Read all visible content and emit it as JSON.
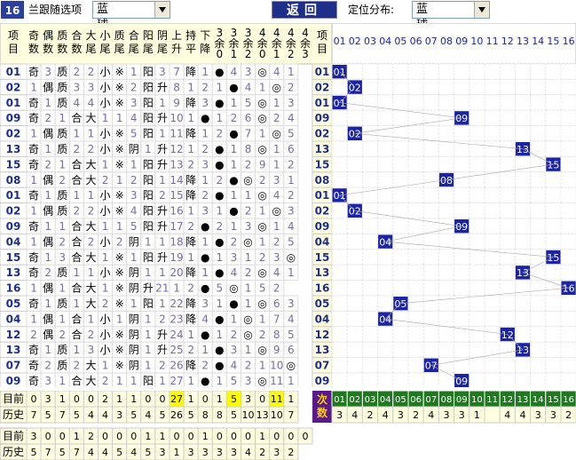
{
  "topbar": {
    "issue_badge": "16",
    "option_label": "兰跟随选项",
    "option_value": "蓝 球",
    "back_button": "返回",
    "dist_label": "定位分布:",
    "dist_value": "蓝 球"
  },
  "headers": {
    "item": "项目",
    "cols": [
      "奇数",
      "偶数",
      "质数",
      "合数",
      "大尾",
      "小尾",
      "质尾",
      "合尾",
      "阳尾",
      "阴尾",
      "上升",
      "持平",
      "下降",
      "3余0",
      "3余1",
      "3余2",
      "4余0",
      "4余1",
      "4余2",
      "4余3"
    ],
    "item_right": "项目",
    "numbers": [
      "01",
      "02",
      "03",
      "04",
      "05",
      "06",
      "07",
      "08",
      "09",
      "10",
      "11",
      "12",
      "13",
      "14",
      "15",
      "16"
    ]
  },
  "rows": [
    {
      "item": "01",
      "c": [
        "奇",
        "3",
        "质",
        "2",
        "2",
        "小",
        "※",
        "1",
        "阳",
        "3",
        "7",
        "降",
        "1",
        "●",
        "4",
        "3",
        "◎",
        "4",
        "1"
      ]
    },
    {
      "item": "02",
      "c": [
        "1",
        "偶",
        "质",
        "3",
        "3",
        "小",
        "※",
        "2",
        "阳",
        "升",
        "8",
        "1",
        "2",
        "1",
        "●",
        "4",
        "1",
        "◎",
        "2"
      ]
    },
    {
      "item": "01",
      "c": [
        "奇",
        "1",
        "质",
        "4",
        "4",
        "小",
        "※",
        "3",
        "阳",
        "1",
        "9",
        "降",
        "3",
        "●",
        "1",
        "5",
        "◎",
        "1",
        "3"
      ]
    },
    {
      "item": "09",
      "c": [
        "奇",
        "2",
        "1",
        "合",
        "大",
        "1",
        "1",
        "4",
        "阳",
        "升",
        "10",
        "1",
        "●",
        "1",
        "2",
        "6",
        "◎",
        "2",
        "4"
      ]
    },
    {
      "item": "02",
      "c": [
        "1",
        "偶",
        "质",
        "1",
        "1",
        "小",
        "※",
        "5",
        "阳",
        "1",
        "11",
        "降",
        "1",
        "2",
        "●",
        "7",
        "1",
        "◎",
        "5"
      ]
    },
    {
      "item": "13",
      "c": [
        "奇",
        "1",
        "质",
        "2",
        "2",
        "小",
        "※",
        "阴",
        "1",
        "升",
        "12",
        "1",
        "2",
        "●",
        "1",
        "8",
        "◎",
        "1",
        "6"
      ]
    },
    {
      "item": "15",
      "c": [
        "奇",
        "2",
        "1",
        "合",
        "大",
        "1",
        "※",
        "1",
        "阳",
        "升",
        "13",
        "2",
        "3",
        "●",
        "1",
        "2",
        "9",
        "1",
        "2"
      ]
    },
    {
      "item": "08",
      "c": [
        "1",
        "偶",
        "2",
        "合",
        "大",
        "2",
        "1",
        "2",
        "阳",
        "1",
        "14",
        "降",
        "1",
        "2",
        "●",
        "◎",
        "2",
        "3",
        "1"
      ]
    },
    {
      "item": "01",
      "c": [
        "奇",
        "1",
        "质",
        "1",
        "1",
        "小",
        "※",
        "3",
        "阳",
        "2",
        "15",
        "降",
        "2",
        "●",
        "1",
        "1",
        "◎",
        "4",
        "2"
      ]
    },
    {
      "item": "02",
      "c": [
        "1",
        "偶",
        "质",
        "2",
        "2",
        "小",
        "※",
        "4",
        "阳",
        "升",
        "16",
        "1",
        "3",
        "1",
        "●",
        "2",
        "1",
        "◎",
        "3"
      ]
    },
    {
      "item": "09",
      "c": [
        "奇",
        "1",
        "1",
        "合",
        "大",
        "1",
        "1",
        "5",
        "阳",
        "升",
        "17",
        "2",
        "●",
        "2",
        "1",
        "3",
        "◎",
        "1",
        "4"
      ]
    },
    {
      "item": "04",
      "c": [
        "1",
        "偶",
        "2",
        "合",
        "2",
        "小",
        "2",
        "阴",
        "1",
        "1",
        "18",
        "降",
        "1",
        "●",
        "2",
        "◎",
        "1",
        "2",
        "5"
      ]
    },
    {
      "item": "15",
      "c": [
        "奇",
        "1",
        "3",
        "合",
        "大",
        "1",
        "※",
        "1",
        "阳",
        "升",
        "19",
        "1",
        "●",
        "1",
        "3",
        "1",
        "2",
        "3",
        "◎"
      ]
    },
    {
      "item": "13",
      "c": [
        "奇",
        "2",
        "质",
        "1",
        "1",
        "小",
        "※",
        "阴",
        "1",
        "1",
        "20",
        "降",
        "1",
        "●",
        "4",
        "2",
        "◎",
        "4",
        "1"
      ]
    },
    {
      "item": "16",
      "c": [
        "1",
        "偶",
        "1",
        "合",
        "大",
        "1",
        "※",
        "阴",
        "升",
        "21",
        "1",
        "2",
        "●",
        "5",
        "◎",
        "1",
        "5",
        "2"
      ]
    },
    {
      "item": "05",
      "c": [
        "奇",
        "1",
        "质",
        "1",
        "大",
        "2",
        "※",
        "1",
        "阳",
        "1",
        "22",
        "降",
        "3",
        "1",
        "●",
        "1",
        "◎",
        "6",
        "3"
      ]
    },
    {
      "item": "04",
      "c": [
        "1",
        "偶",
        "1",
        "合",
        "1",
        "小",
        "1",
        "阴",
        "1",
        "2",
        "23",
        "降",
        "4",
        "●",
        "1",
        "◎",
        "1",
        "7",
        "4"
      ]
    },
    {
      "item": "12",
      "c": [
        "2",
        "偶",
        "2",
        "合",
        "2",
        "小",
        "※",
        "阴",
        "1",
        "升",
        "24",
        "1",
        "●",
        "1",
        "2",
        "◎",
        "2",
        "8",
        "5"
      ]
    },
    {
      "item": "13",
      "c": [
        "奇",
        "1",
        "质",
        "1",
        "3",
        "小",
        "※",
        "阴",
        "1",
        "升",
        "25",
        "2",
        "1",
        "●",
        "3",
        "1",
        "◎",
        "9",
        "6"
      ]
    },
    {
      "item": "07",
      "c": [
        "奇",
        "2",
        "质",
        "2",
        "大",
        "1",
        "※",
        "阴",
        "1",
        "2",
        "26",
        "降",
        "2",
        "●",
        "4",
        "2",
        "1",
        "10",
        "◎"
      ]
    },
    {
      "item": "09",
      "c": [
        "奇",
        "3",
        "1",
        "合",
        "大",
        "2",
        "1",
        "1",
        "阳",
        "1",
        "27",
        "1",
        "●",
        "1",
        "5",
        "3",
        "◎",
        "11",
        "1"
      ]
    }
  ],
  "footer": {
    "row1_label": "目前",
    "row1": [
      "0",
      "3",
      "1",
      "0",
      "0",
      "2",
      "1",
      "1",
      "0",
      "0",
      "27",
      "1",
      "0",
      "1",
      "5",
      "3",
      "0",
      "11",
      "1"
    ],
    "row2_label": "历史",
    "row2": [
      "7",
      "5",
      "7",
      "5",
      "4",
      "4",
      "3",
      "5",
      "4",
      "5",
      "26",
      "5",
      "8",
      "8",
      "5",
      "10",
      "13",
      "10",
      "7"
    ],
    "next_label": "次数",
    "next_counts": [
      "3",
      "4",
      "2",
      "4",
      "3",
      "2",
      "4",
      "3",
      "3",
      "1",
      "",
      "4",
      "4",
      "3",
      "3",
      "2"
    ],
    "row3_label": "目前",
    "row3": [
      "3",
      "0",
      "0",
      "1",
      "2",
      "0",
      "0",
      "0",
      "1",
      "1",
      "0",
      "0",
      "1",
      "0",
      "0",
      "0",
      "1",
      "0",
      "0",
      "0"
    ],
    "row4_label": "历史",
    "row4": [
      "5",
      "7",
      "5",
      "7",
      "4",
      "4",
      "5",
      "4",
      "5",
      "3",
      "1",
      "3",
      "3",
      "3",
      "3",
      "4",
      "2",
      "3",
      "2"
    ]
  },
  "colors": {
    "row_num": "#1e2f8a",
    "blue_cell": "#1a24a5",
    "hdr_bg": "#ffffe0",
    "yellow": "#ffff00",
    "green_hdr": "#1f7a1f",
    "purple": "#5b1a8a"
  }
}
